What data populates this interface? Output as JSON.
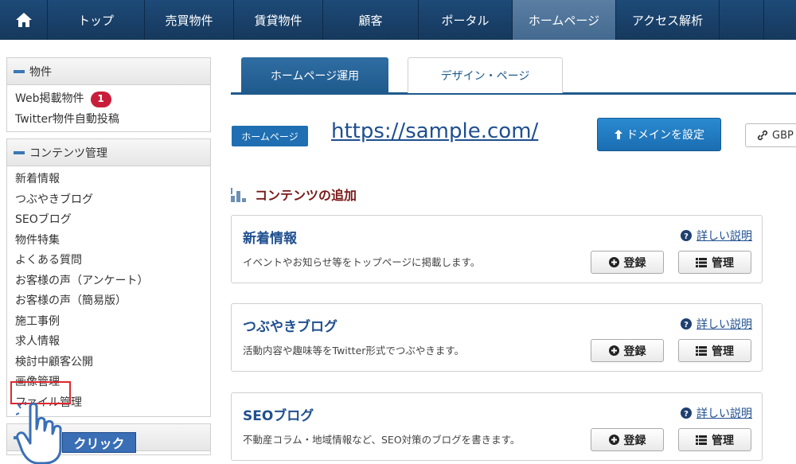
{
  "nav": {
    "items": [
      "トップ",
      "売買物件",
      "賃貸物件",
      "顧客",
      "ポータル",
      "ホームページ",
      "アクセス解析"
    ],
    "active": "ホームページ"
  },
  "sidebar": {
    "sections": [
      {
        "title": "物件",
        "items": [
          {
            "label": "Web掲載物件",
            "badge": "1"
          },
          {
            "label": "Twitter物件自動投稿"
          }
        ]
      },
      {
        "title": "コンテンツ管理",
        "items": [
          {
            "label": "新着情報"
          },
          {
            "label": "つぶやきブログ"
          },
          {
            "label": "SEOブログ"
          },
          {
            "label": "物件特集"
          },
          {
            "label": "よくある質問"
          },
          {
            "label": "お客様の声（アンケート）"
          },
          {
            "label": "お客様の声（簡易版）"
          },
          {
            "label": "施工事例"
          },
          {
            "label": "求人情報"
          },
          {
            "label": "検討中顧客公開"
          },
          {
            "label": "画像管理"
          },
          {
            "label": "ファイル管理"
          }
        ]
      }
    ]
  },
  "annotation": {
    "click_label": "クリック"
  },
  "tabs": [
    {
      "label": "ホームページ運用",
      "active": true
    },
    {
      "label": "デザイン・ページ",
      "active": false
    }
  ],
  "homepage": {
    "label": "ホームページ",
    "url": "https://sample.com/",
    "domain_button": "ドメインを設定",
    "gbp_button": "GBP"
  },
  "section_title": "コンテンツの追加",
  "cards": [
    {
      "title": "新着情報",
      "desc": "イベントやお知らせ等をトップページに掲載します。",
      "help": "詳しい説明",
      "register": "登録",
      "manage": "管理"
    },
    {
      "title": "つぶやきブログ",
      "desc": "活動内容や趣味等をTwitter形式でつぶやきます。",
      "help": "詳しい説明",
      "register": "登録",
      "manage": "管理"
    },
    {
      "title": "SEOブログ",
      "desc": "不動産コラム・地域情報など、SEO対策のブログを書きます。",
      "help": "詳しい説明",
      "register": "登録",
      "manage": "管理"
    }
  ],
  "colors": {
    "nav_bg": "#16385c",
    "accent": "#1f5a8c",
    "badge": "#c81e3a",
    "highlight": "#e0282e"
  }
}
